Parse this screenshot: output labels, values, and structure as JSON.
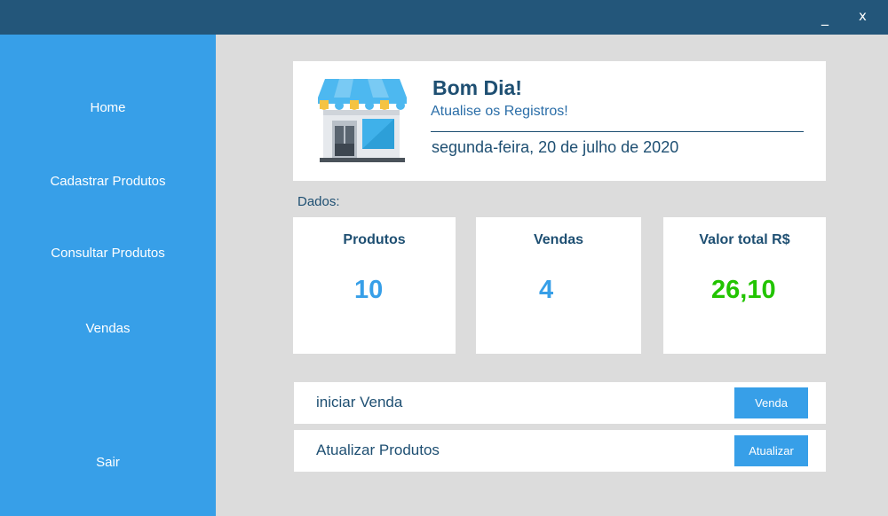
{
  "window": {
    "minimize_label": "_",
    "close_label": "x"
  },
  "sidebar": {
    "items": [
      {
        "label": "Home"
      },
      {
        "label": "Cadastrar Produtos"
      },
      {
        "label": "Consultar Produtos"
      },
      {
        "label": "Vendas"
      },
      {
        "label": "Sair"
      }
    ]
  },
  "header": {
    "icon": "store-icon",
    "greeting": "Bom Dia!",
    "subtitle": "Atualise os Registros!",
    "date": "segunda-feira, 20 de julho de 2020"
  },
  "stats": {
    "section_label": "Dados:",
    "items": [
      {
        "title": "Produtos",
        "value": "10",
        "color": "#379fe8"
      },
      {
        "title": "Vendas",
        "value": "4",
        "color": "#379fe8"
      },
      {
        "title": "Valor total R$",
        "value": "26,10",
        "color": "#22c400"
      }
    ]
  },
  "actions": [
    {
      "label": "iniciar Venda",
      "button": "Venda"
    },
    {
      "label": "Atualizar Produtos",
      "button": "Atualizar"
    }
  ],
  "colors": {
    "titlebar": "#23567a",
    "sidebar": "#379fe8",
    "background": "#dcdcdc",
    "text_dark": "#1e4f72",
    "value_blue": "#379fe8",
    "value_green": "#22c400"
  }
}
